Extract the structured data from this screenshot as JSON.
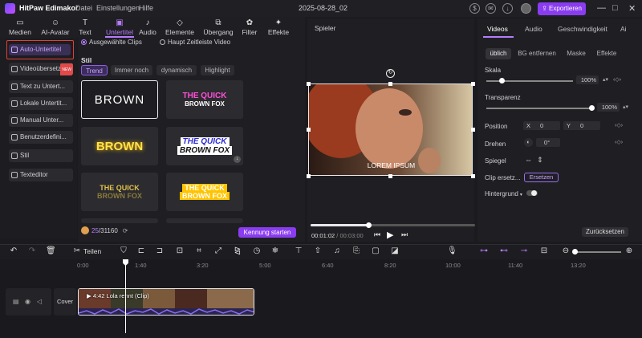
{
  "app": {
    "name": "HitPaw Edimakor",
    "menu": [
      "Datei",
      "Einstellungen",
      "Hilfe"
    ],
    "document": "2025-08-28_02",
    "export_label": "Exportieren"
  },
  "toolbar": [
    {
      "label": "Medien",
      "icon": "media-icon"
    },
    {
      "label": "AI-Avatar",
      "icon": "avatar-icon"
    },
    {
      "label": "Text",
      "icon": "text-icon"
    },
    {
      "label": "Untertitel",
      "icon": "subtitle-icon",
      "active": true
    },
    {
      "label": "Audio",
      "icon": "audio-icon"
    },
    {
      "label": "Elemente",
      "icon": "elements-icon"
    },
    {
      "label": "Übergang",
      "icon": "transition-icon"
    },
    {
      "label": "Filter",
      "icon": "filter-icon"
    },
    {
      "label": "Effekte",
      "icon": "effects-icon"
    }
  ],
  "sidebar": {
    "items": [
      {
        "label": "Auto-Untertitel",
        "badge": ""
      },
      {
        "label": "Videoübersetzer",
        "badge": "NEW"
      },
      {
        "label": "Text zu Untert..."
      },
      {
        "label": "Lokale Untertit..."
      },
      {
        "label": "Manual Unter..."
      },
      {
        "label": "Benutzerdefini..."
      },
      {
        "label": "Stil"
      },
      {
        "label": "Texteditor"
      }
    ]
  },
  "subtitles": {
    "scope_options": [
      "Ausgewählte Clips",
      "Haupt Zeitleiste Video"
    ],
    "style_heading": "Stil",
    "style_tabs": [
      "Trend",
      "Immer noch",
      "dynamisch",
      "Highlight"
    ],
    "cards": [
      {
        "lines": [
          "BROWN"
        ],
        "style": "outline"
      },
      {
        "lines": [
          "THE QUICK",
          "BROWN FOX"
        ],
        "style": "pink-white"
      },
      {
        "lines": [
          "BROWN"
        ],
        "style": "yellow-glow"
      },
      {
        "lines": [
          "THE QUICK",
          "BROWN FOX"
        ],
        "style": "sticker"
      },
      {
        "lines": [
          "THE QUICK",
          "BROWN FOX"
        ],
        "style": "gold-outline"
      },
      {
        "lines": [
          "THE QUICK",
          "BROWN FOX"
        ],
        "style": "yellow-box"
      }
    ],
    "credits_used": "25",
    "credits_total": "/31160",
    "start_label": "Kennung starten"
  },
  "player": {
    "title": "Spieler",
    "caption": "LOREM IPSUM",
    "current_time": "00:01:02",
    "total_time": "00:03:00",
    "progress": 0.35
  },
  "properties": {
    "tabs": [
      "Videos",
      "Audio",
      "Geschwindigkeit",
      "Ai"
    ],
    "subtabs": [
      "üblich",
      "BG entfernen",
      "Maske",
      "Effekte"
    ],
    "scale": {
      "label": "Skala",
      "value": "100%",
      "level": 0.04
    },
    "opacity": {
      "label": "Transparenz",
      "value": "100%",
      "level": 1.0
    },
    "position": {
      "label": "Position",
      "x_label": "X",
      "x": "0",
      "y_label": "Y",
      "y": "0"
    },
    "rotate": {
      "label": "Drehen",
      "value": "0°"
    },
    "mirror": {
      "label": "Spiegel"
    },
    "replace": {
      "label": "Clip ersetz...",
      "button": "Ersetzen"
    },
    "background": {
      "label": "Hintergrund"
    },
    "reset": "Zurücksetzen"
  },
  "timeline": {
    "split_label": "Teilen",
    "ticks": [
      "0:00",
      "1:40",
      "3:20",
      "5:00",
      "6:40",
      "8:20",
      "10:00",
      "11:40",
      "13:20"
    ],
    "cover_label": "Cover",
    "clip_label": "4:42 Lola rennt (Clip)"
  },
  "colors": {
    "accent": "#8a3cf0",
    "highlight": "#e0403a"
  }
}
